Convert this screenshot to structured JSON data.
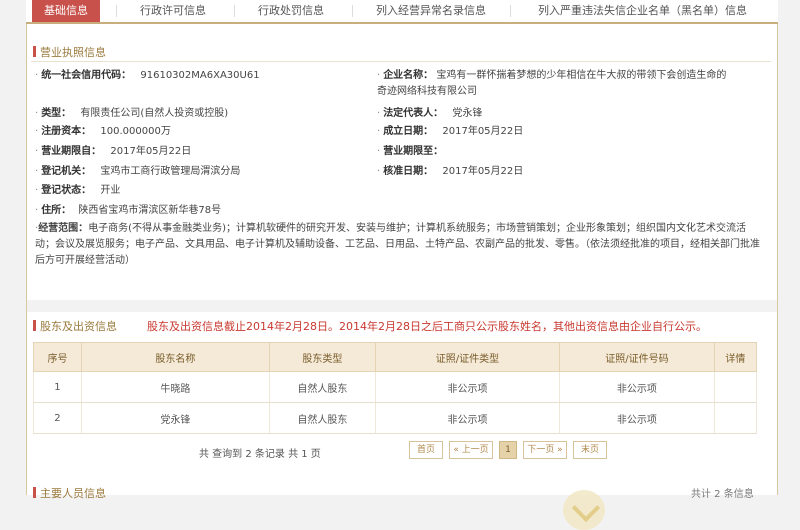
{
  "tabs": [
    {
      "label": "基础信息"
    },
    {
      "label": "行政许可信息"
    },
    {
      "label": "行政处罚信息"
    },
    {
      "label": "列入经营异常名录信息"
    },
    {
      "label": "列入严重违法失信企业名单（黑名单）信息"
    }
  ],
  "license": {
    "heading": "营业执照信息",
    "credit_code_label": "统一社会信用代码：",
    "credit_code": "91610302MA6XA30U61",
    "company_name_label": "企业名称：",
    "company_name_line1": "宝鸡有一群怀揣着梦想的少年相信在牛大叔的带领下会创造生命的",
    "company_name_line2": "奇迹网络科技有限公司",
    "type_label": "类型：",
    "type": "有限责任公司(自然人投资或控股)",
    "legal_rep_label": "法定代表人：",
    "legal_rep": "党永锋",
    "capital_label": "注册资本：",
    "capital": "100.000000万",
    "founded_label": "成立日期：",
    "founded": "2017年05月22日",
    "term_from_label": "营业期限自：",
    "term_from": "2017年05月22日",
    "term_to_label": "营业期限至：",
    "term_to": "",
    "authority_label": "登记机关：",
    "authority": "宝鸡市工商行政管理局渭滨分局",
    "approved_label": "核准日期：",
    "approved": "2017年05月22日",
    "status_label": "登记状态：",
    "status": "开业",
    "address_label": "住所：",
    "address": "陕西省宝鸡市渭滨区新华巷78号",
    "scope_label": "经营范围：",
    "scope": "电子商务(不得从事金融类业务)；计算机软硬件的研究开发、安装与维护；计算机系统服务；市场营销策划；企业形象策划；组织国内文化艺术交流活动；会议及展览服务；电子产品、文具用品、电子计算机及辅助设备、工艺品、日用品、土特产品、农副产品的批发、零售。（依法须经批准的项目，经相关部门批准后方可开展经营活动）"
  },
  "shareholders": {
    "heading": "股东及出资信息",
    "notice": "股东及出资信息截止2014年2月28日。2014年2月28日之后工商只公示股东姓名，其他出资信息由企业自行公示。",
    "columns": [
      "序号",
      "股东名称",
      "股东类型",
      "证照/证件类型",
      "证照/证件号码",
      "详情"
    ],
    "rows": [
      {
        "no": "1",
        "name": "牛晓路",
        "type": "自然人股东",
        "id_type": "非公示项",
        "id_no": "非公示项",
        "detail": ""
      },
      {
        "no": "2",
        "name": "党永锋",
        "type": "自然人股东",
        "id_type": "非公示项",
        "id_no": "非公示项",
        "detail": ""
      }
    ],
    "pager_info": "共 查询到 2 条记录 共 1 页",
    "pager": {
      "first": "首页",
      "prev": "« 上一页",
      "current": "1",
      "next": "下一页 »",
      "last": "末页"
    }
  },
  "next_section": {
    "heading": "主要人员信息",
    "count": "共计 2 条信息"
  }
}
